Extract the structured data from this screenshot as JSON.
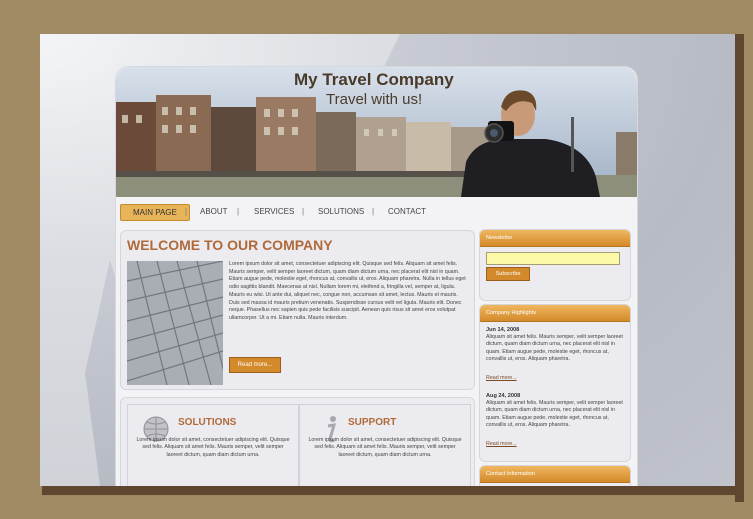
{
  "site": {
    "title": "My Travel Company",
    "tagline": "Travel with us!"
  },
  "nav": {
    "items": [
      {
        "label": "MAIN PAGE"
      },
      {
        "label": "ABOUT"
      },
      {
        "label": "SERVICES"
      },
      {
        "label": "SOLUTIONS"
      },
      {
        "label": "CONTACT"
      }
    ],
    "separator": "|"
  },
  "welcome": {
    "heading": "WELCOME TO OUR COMPANY",
    "body": "Lorem ipsum dolor sit amet, consectetuer adipiscing elit. Quisque sed felis. Aliquam sit amet felis. Mauris semper, velit semper laoreet dictum, quam diam dictum urna, nec placerat elit nisl in quam. Etiam augue pede, molestie eget, rhoncus at, convallis ut, eros. Aliquam pharetra. Nulla in tellus eget odio sagittis blandit. Maecenas at nisl. Nullam lorem mi, eleifend a, fringilla vel, semper at, ligula. Mauris eu wisi. Ut ante dui, aliquet nec, congue non, accumsan sit amet, lectus. Mauris et mauris. Duis sed massa id mauris pretium venenatis. Suspendisse cursus velit vel ligula. Mauris elit. Donec neque. Phasellus nec sapien quis pede facilisis suscipit. Aenean quis risus sit amet eros volutpat ullamcorper. Ut a mi. Etiam nulla. Mauris interdum.",
    "read_more": "Read more..."
  },
  "solutions": {
    "title": "SOLUTIONS",
    "icon": "globe-icon",
    "text": "Lorem ipsum dolor sit amet, consectetuer adipiscing elit. Quisque sed felis. Aliquam sit amet felis. Mauris semper, velit semper laoreet dictum, quam diam dictum urna."
  },
  "support": {
    "title": "SUPPORT",
    "icon": "info-icon",
    "text": "Lorem ipsum dolor sit amet, consectetuer adipiscing elit. Quisque sed felis. Aliquam sit amet felis. Mauris semper, velit semper laoreet dictum, quam diam dictum urna."
  },
  "newsletter": {
    "title": "Newsletter",
    "input_value": "",
    "subscribe_label": "Subscribe"
  },
  "highlights": {
    "title": "Company Highlights",
    "items": [
      {
        "date": "Jun 14, 2008",
        "text": "Aliquam sit amet felis. Mauris semper, velit semper laoreet dictum, quam diam dictum urna, nec placerat elit nisl in quam. Etiam augue pede, molestie eget, rhoncus at, convallis ut, eros. Aliquam pharetra.",
        "link": "Read more..."
      },
      {
        "date": "Aug 24, 2008",
        "text": "Aliquam sit amet felis. Mauris semper, velit semper laoreet dictum, quam diam dictum urna, nec placerat elit nisl in quam. Etiam augue pede, molestie eget, rhoncus at, convallis ut, eros. Aliquam pharetra.",
        "link": "Read more..."
      }
    ]
  },
  "contact": {
    "title": "Contact Information"
  },
  "colors": {
    "frame": "#a08a63",
    "accent": "#d38a2a",
    "heading": "#b06a3a",
    "title": "#4a3a2a"
  }
}
